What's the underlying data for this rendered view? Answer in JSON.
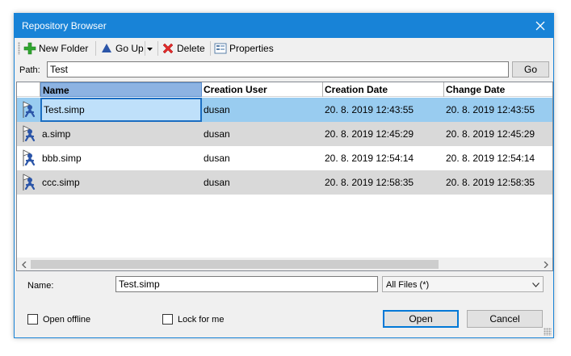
{
  "window": {
    "title": "Repository Browser"
  },
  "toolbar": {
    "new_folder": "New Folder",
    "go_up": "Go Up",
    "delete": "Delete",
    "properties": "Properties"
  },
  "path": {
    "label": "Path:",
    "value": "Test",
    "go": "Go"
  },
  "grid": {
    "columns": [
      "Name",
      "Creation User",
      "Creation Date",
      "Change Date"
    ],
    "rows": [
      {
        "name": "Test.simp",
        "user": "dusan",
        "created": "20. 8. 2019 12:43:55",
        "changed": "20. 8. 2019 12:43:55",
        "selected": true
      },
      {
        "name": "a.simp",
        "user": "dusan",
        "created": "20. 8. 2019 12:45:29",
        "changed": "20. 8. 2019 12:45:29",
        "selected": false
      },
      {
        "name": "bbb.simp",
        "user": "dusan",
        "created": "20. 8. 2019 12:54:14",
        "changed": "20. 8. 2019 12:54:14",
        "selected": false
      },
      {
        "name": "ccc.simp",
        "user": "dusan",
        "created": "20. 8. 2019 12:58:35",
        "changed": "20. 8. 2019 12:58:35",
        "selected": false
      }
    ],
    "row_icon": "repository-file-icon"
  },
  "footer": {
    "name_label": "Name:",
    "name_value": "Test.simp",
    "filter_value": "All Files (*)",
    "open_offline": "Open offline",
    "lock_for_me": "Lock for me",
    "open": "Open",
    "cancel": "Cancel"
  },
  "colors": {
    "titlebar": "#1883d7",
    "selected_row": "#99ccf0",
    "alt_row": "#d9d9d9",
    "header_selected": "#8db3e2"
  }
}
